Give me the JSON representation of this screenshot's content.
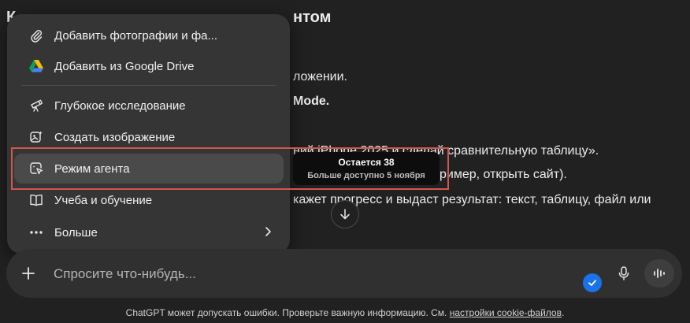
{
  "background": {
    "title_left": "К",
    "title_right": "нтом",
    "line_small": "I",
    "line1": "ложении.",
    "line2": "Mode.",
    "line3": "ний iPhone 2025 и сделай сравнительную таблицу».",
    "line4": "ример, открыть сайт).",
    "line5": "кажет прогресс и выдаст результат: текст, таблицу, файл или"
  },
  "menu": {
    "items": [
      {
        "label": "Добавить фотографии и фа...",
        "icon": "paperclip-icon"
      },
      {
        "label": "Добавить из Google Drive",
        "icon": "google-drive-icon"
      },
      {
        "label": "Глубокое исследование",
        "icon": "telescope-icon"
      },
      {
        "label": "Создать изображение",
        "icon": "image-create-icon"
      },
      {
        "label": "Режим агента",
        "icon": "agent-cursor-icon"
      },
      {
        "label": "Учеба и обучение",
        "icon": "book-icon"
      },
      {
        "label": "Больше",
        "icon": "more-dots-icon"
      }
    ]
  },
  "tooltip": {
    "line1": "Остается 38",
    "line2": "Больше доступно 5 ноября"
  },
  "composer": {
    "placeholder": "Спросите что-нибудь..."
  },
  "footer": {
    "text": "ChatGPT может допускать ошибки. Проверьте важную информацию. См. ",
    "link": "настройки cookie-файлов",
    "end": "."
  },
  "colors": {
    "background": "#212121",
    "menu": "#353535",
    "highlight": "#d0574f",
    "accent_blue": "#1a73e8"
  }
}
